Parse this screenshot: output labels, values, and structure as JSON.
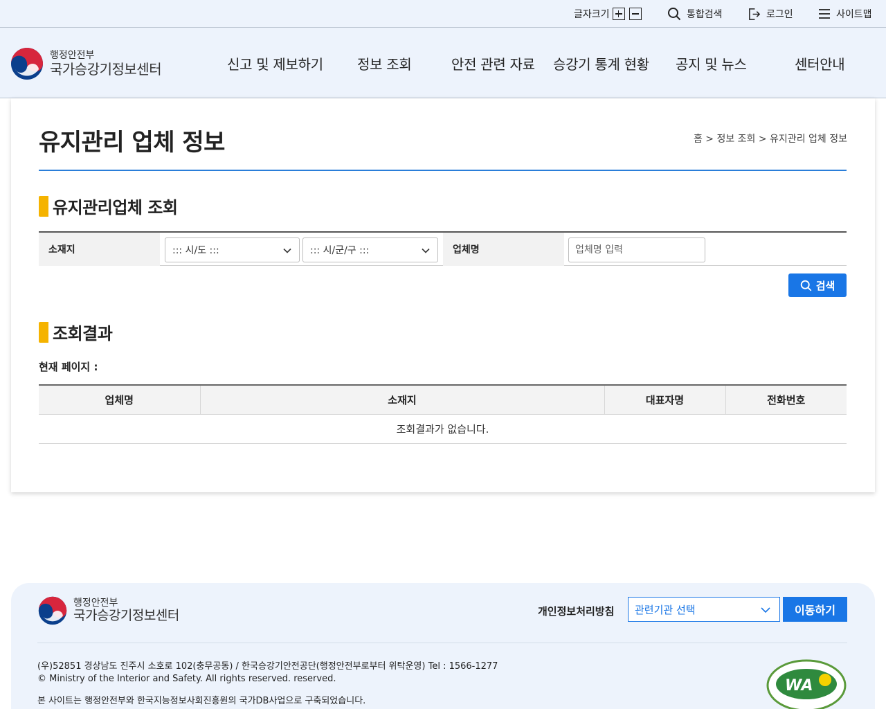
{
  "util": {
    "font_size_label": "글자크기",
    "search_label": "통합검색",
    "login_label": "로그인",
    "sitemap_label": "사이트맵"
  },
  "header": {
    "logo_small": "행정안전부",
    "logo_big": "국가승강기정보센터",
    "nav": [
      "신고 및 제보하기",
      "정보 조회",
      "안전 관련 자료",
      "승강기 통계 현황",
      "공지 및 뉴스",
      "센터안내"
    ]
  },
  "page": {
    "title": "유지관리 업체 정보",
    "breadcrumb": "홈 > 정보 조회 > 유지관리 업체 정보"
  },
  "search": {
    "section_title": "유지관리업체 조회",
    "location_label": "소재지",
    "sido_value": "::: 시/도 :::",
    "sigungu_value": "::: 시/군/구 :::",
    "company_label": "업체명",
    "company_placeholder": "업체명 입력",
    "button_label": "검색"
  },
  "results": {
    "section_title": "조회결과",
    "current_page_label": "현재 페이지 :",
    "columns": [
      "업체명",
      "소재지",
      "대표자명",
      "전화번호"
    ],
    "empty_message": "조회결과가 없습니다."
  },
  "footer": {
    "logo_small": "행정안전부",
    "logo_big": "국가승강기정보센터",
    "privacy_label": "개인정보처리방침",
    "select_value": "관련기관 선택",
    "go_label": "이동하기",
    "address": "(우)52851 경상남도 진주시 소호로 102(충무공동) / 한국승강기안전공단(행정안전부로부터 위탁운영) Tel : 1566-1277",
    "copyright": "© Ministry of the Interior and Safety. All rights reserved. reserved.",
    "notice": "본 사이트는 행정안전부와 한국지능정보사회진흥원의 국가DB사업으로 구축되었습니다."
  },
  "colors": {
    "accent_blue": "#1976e6",
    "section_bar": "#f5b300",
    "header_bg": "#edf3fc"
  }
}
